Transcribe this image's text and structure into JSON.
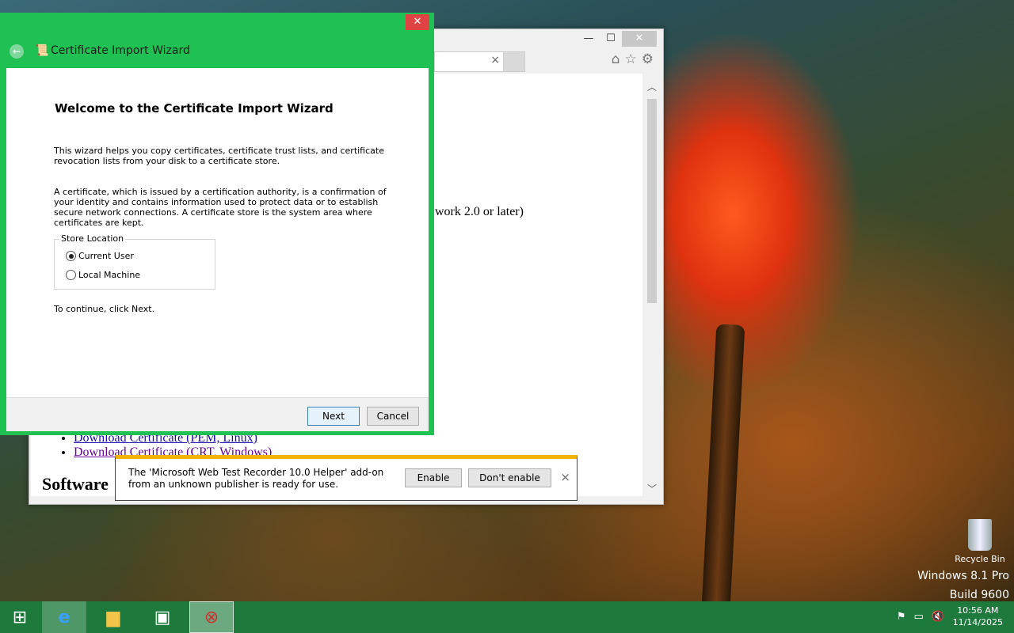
{
  "desktop": {
    "recycle_bin_label": "Recycle Bin",
    "os_name": "Windows 8.1 Pro",
    "build": "Build 9600"
  },
  "ie": {
    "minimize": "—",
    "maximize": "☐",
    "close": "✕",
    "tab_close": "×",
    "partial_text": "work 2.0 or later)",
    "links": [
      "Download Certificate (PEM, Linux)",
      "Download Certificate (CRT, Windows)"
    ],
    "heading_partial": "Software"
  },
  "notification": {
    "message": "The 'Microsoft Web Test Recorder 10.0 Helper' add-on from an unknown publisher is ready for use.",
    "enable_label": "Enable",
    "dont_enable_label": "Don't enable",
    "close": "×"
  },
  "wizard": {
    "window_title": "Certificate Import Wizard",
    "close": "✕",
    "heading": "Welcome to the Certificate Import Wizard",
    "para1": "This wizard helps you copy certificates, certificate trust lists, and certificate revocation lists from your disk to a certificate store.",
    "para2": "A certificate, which is issued by a certification authority, is a confirmation of your identity and contains information used to protect data or to establish secure network connections. A certificate store is the system area where certificates are kept.",
    "store_location_label": "Store Location",
    "options": [
      "Current User",
      "Local Machine"
    ],
    "selected_option": "Current User",
    "continue_text": "To continue, click Next.",
    "next_label": "Next",
    "cancel_label": "Cancel"
  },
  "taskbar": {
    "time": "10:56 AM",
    "date": "11/14/2025"
  }
}
